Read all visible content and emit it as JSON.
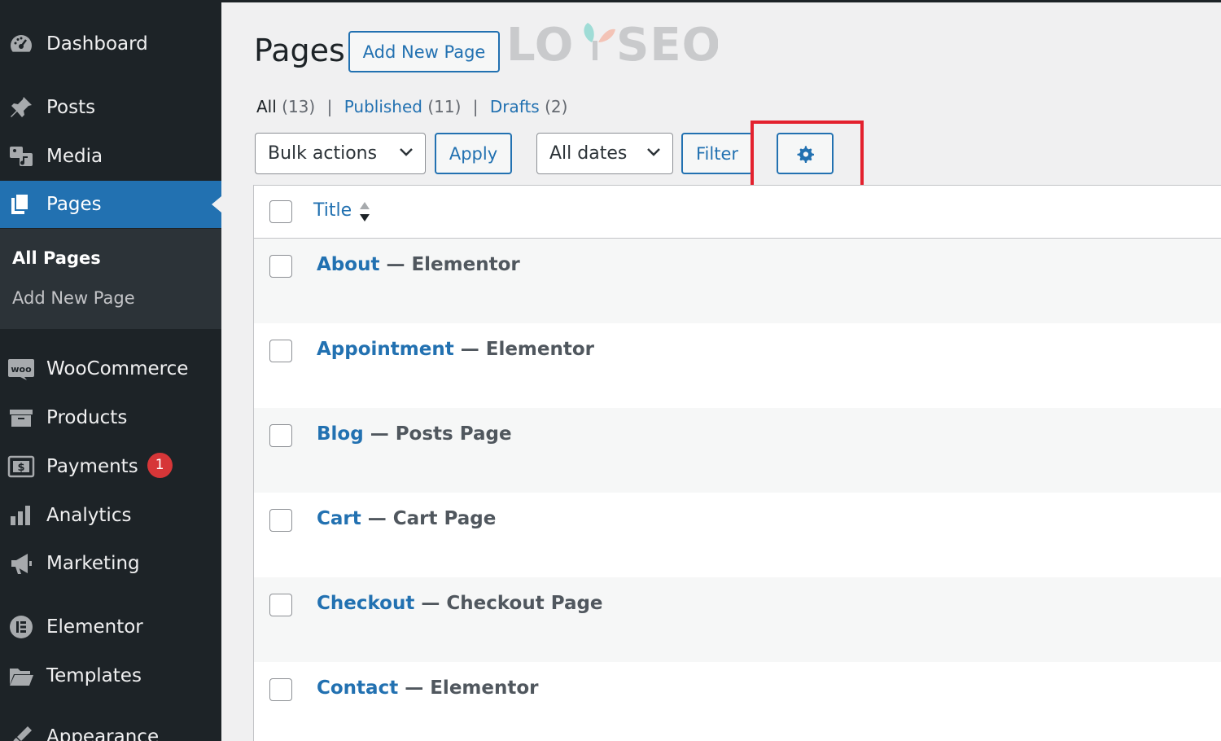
{
  "sidebar": {
    "items": [
      {
        "label": "Dashboard",
        "icon": "dashboard-icon"
      },
      {
        "label": "Posts",
        "icon": "pushpin-icon"
      },
      {
        "label": "Media",
        "icon": "media-icon"
      },
      {
        "label": "Pages",
        "icon": "pages-icon",
        "active": true
      },
      {
        "label": "WooCommerce",
        "icon": "woocommerce-icon"
      },
      {
        "label": "Products",
        "icon": "archive-box-icon"
      },
      {
        "label": "Payments",
        "icon": "dollar-icon",
        "badge": "1"
      },
      {
        "label": "Analytics",
        "icon": "bar-chart-icon"
      },
      {
        "label": "Marketing",
        "icon": "megaphone-icon"
      },
      {
        "label": "Elementor",
        "icon": "elementor-icon"
      },
      {
        "label": "Templates",
        "icon": "folder-icon"
      },
      {
        "label": "Appearance",
        "icon": "paintbrush-icon"
      }
    ],
    "submenu": [
      {
        "label": "All Pages",
        "current": true
      },
      {
        "label": "Add New Page"
      }
    ]
  },
  "header": {
    "title": "Pages",
    "add_new_label": "Add New Page",
    "watermark": "LOYSEO"
  },
  "views": {
    "all_label": "All",
    "all_count": "(13)",
    "published_label": "Published",
    "published_count": "(11)",
    "drafts_label": "Drafts",
    "drafts_count": "(2)"
  },
  "toolbar": {
    "bulk_actions": "Bulk actions",
    "apply_label": "Apply",
    "dates": "All dates",
    "filter_label": "Filter",
    "settings_icon": "gear-icon"
  },
  "table": {
    "title_header": "Title",
    "rows": [
      {
        "title": "About",
        "state": "Elementor"
      },
      {
        "title": "Appointment",
        "state": "Elementor"
      },
      {
        "title": "Blog",
        "state": "Posts Page"
      },
      {
        "title": "Cart",
        "state": "Cart Page"
      },
      {
        "title": "Checkout",
        "state": "Checkout Page"
      },
      {
        "title": "Contact",
        "state": "Elementor"
      }
    ]
  },
  "colors": {
    "sidebar_bg": "#1d2327",
    "accent": "#2271b1",
    "highlight": "#e3212e",
    "badge": "#d63638"
  }
}
